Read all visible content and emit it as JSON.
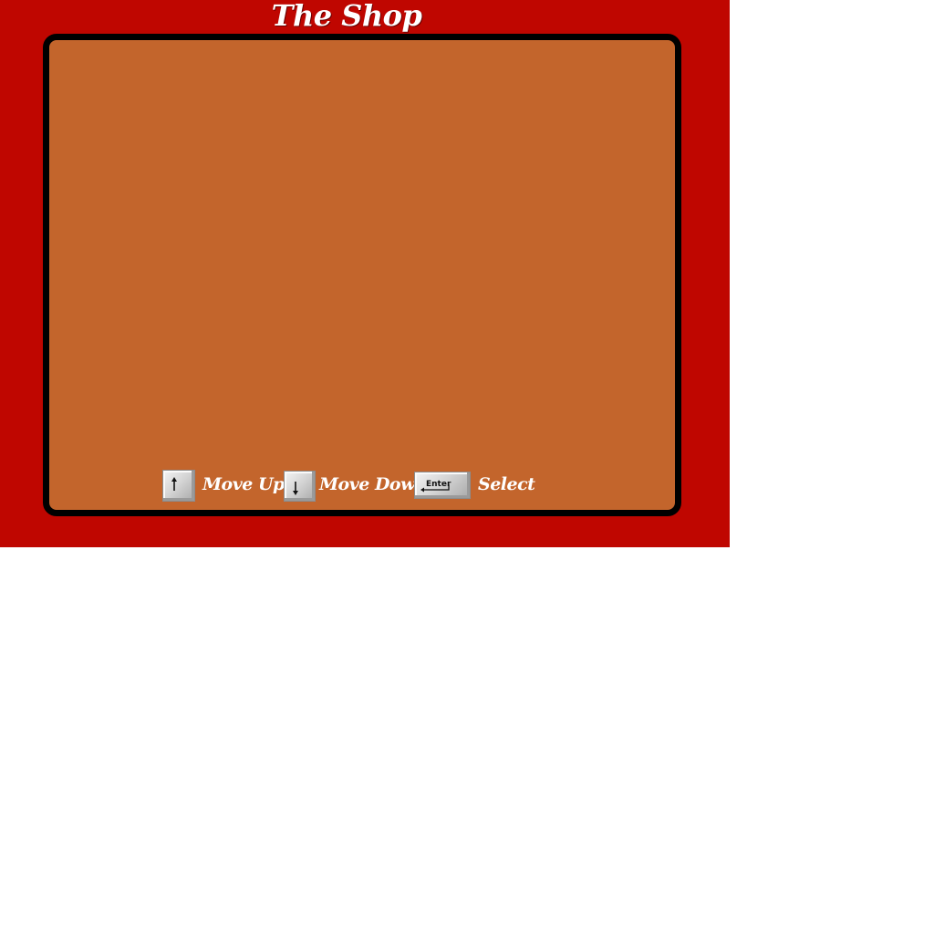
{
  "screen": {
    "title": "The Shop",
    "background_color": "#bf0600",
    "panel_color": "#c3652c",
    "panel_border_color": "#000000"
  },
  "controls": {
    "move_up": {
      "icon": "arrow-up-key-icon",
      "label": "Move Up"
    },
    "move_down": {
      "icon": "arrow-down-key-icon",
      "label": "Move Down"
    },
    "select": {
      "icon": "enter-key-icon",
      "key_text": "Enter",
      "label": "Select"
    }
  }
}
